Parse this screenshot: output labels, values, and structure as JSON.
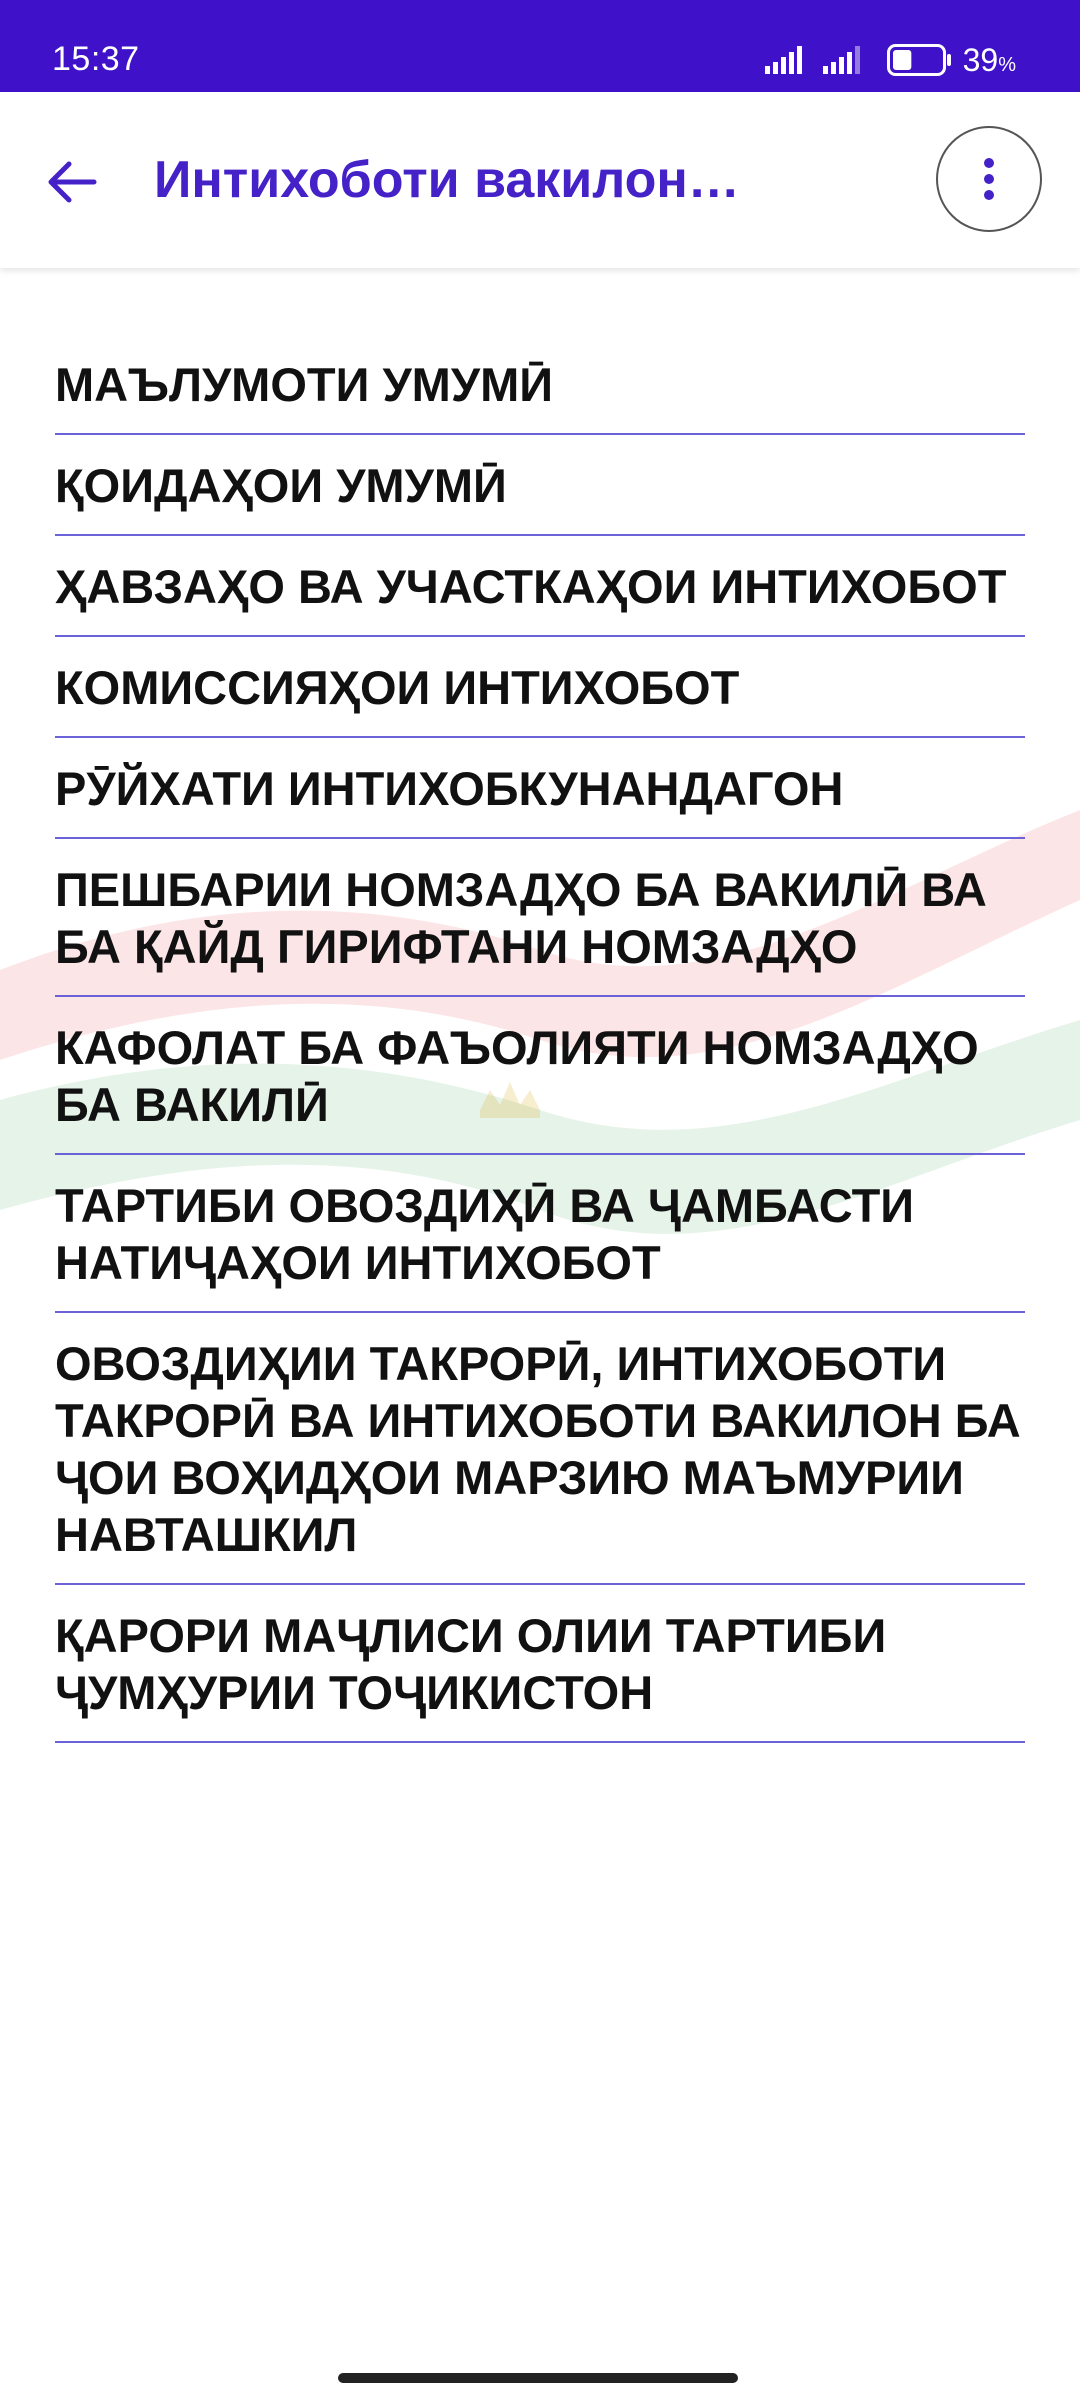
{
  "status_bar": {
    "time": "15:37",
    "battery_percent": "39",
    "battery_unit": "%",
    "battery_level": 0.39,
    "background_color": "#3f12c9"
  },
  "app_bar": {
    "title": "Интихоботи вакилон…",
    "back_icon": "arrow-left-icon",
    "more_icon": "more-vertical-icon",
    "title_color": "#4521c8"
  },
  "menu": {
    "items": [
      {
        "label": "МАЪЛУМОТИ УМУМӢ"
      },
      {
        "label": "ҚОИДАҲОИ УМУМӢ"
      },
      {
        "label": "ҲАВЗАҲО ВА УЧАСТКАҲОИ ИНТИХОБОТ"
      },
      {
        "label": "КОМИССИЯҲОИ ИНТИХОБОТ"
      },
      {
        "label": "РӮЙХАТИ ИНТИХОБКУНАНДАГОН"
      },
      {
        "label": "ПЕШБАРИИ НОМЗАДҲО БА ВАКИЛӢ ВА БА ҚАЙД ГИРИФТАНИ НОМЗАДҲО"
      },
      {
        "label": "КАФОЛАТ БА ФАЪОЛИЯТИ НОМЗАДҲО БА ВАКИЛӢ"
      },
      {
        "label": "ТАРТИБИ ОВОЗДИҲӢ ВА ҶАМБАСТИ НАТИҶАҲОИ ИНТИХОБОТ"
      },
      {
        "label": "ОВОЗДИҲИИ ТАКРОРӢ, ИНТИХОБОТИ ТАКРОРӢ ВА ИНТИХОБОТИ ВАКИЛОН БА ҶОИ ВОҲИДҲОИ МАРЗИЮ МАЪМУРИИ НАВТАШКИЛ"
      },
      {
        "label": "ҚАРОРИ МАҶЛИСИ ОЛИИ ТАРТИБИ ҶУМҲУРИИ ТОҶИКИСТОН"
      }
    ],
    "divider_color": "#6b61d8"
  },
  "background": {
    "watermark": "tajikistan-flag-watermark",
    "colors": [
      "#e8474f",
      "#ffffff",
      "#2e9b4e"
    ]
  }
}
